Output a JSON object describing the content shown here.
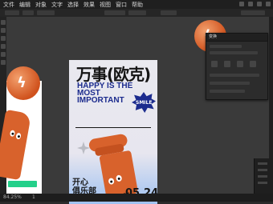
{
  "menu": [
    "文件",
    "编辑",
    "对象",
    "文字",
    "选择",
    "效果",
    "视图",
    "窗口",
    "帮助"
  ],
  "panel": {
    "title": "变换"
  },
  "poster": {
    "title": "万事(欧克)",
    "slogan_lines": [
      "HAPPY IS THE",
      "MOST",
      "IMPORTANT"
    ],
    "badge": "SMILE",
    "club_lines": [
      "开心",
      "俱乐部"
    ],
    "date": "05.24"
  },
  "status": {
    "zoom": "84.25%",
    "page": "1"
  },
  "colors": {
    "orange": "#d8622c",
    "navy": "#1c2c8e",
    "green": "#24d08a",
    "sky": "#9fc1f0"
  }
}
